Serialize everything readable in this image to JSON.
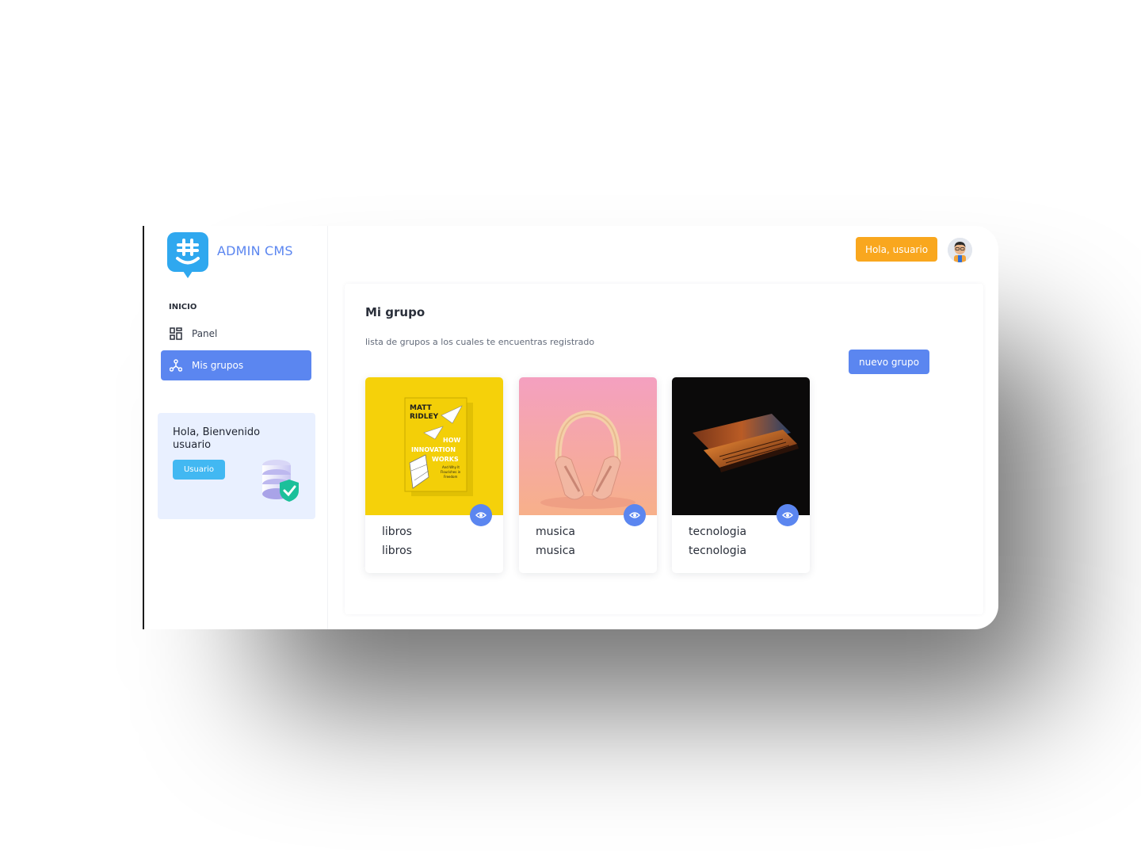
{
  "brand": {
    "name": "ADMIN CMS",
    "accent": "#5b86f0",
    "logo_icon": "hash-smile-chat-icon"
  },
  "sidebar": {
    "section_label": "INICIO",
    "items": [
      {
        "label": "Panel",
        "icon": "dashboard-grid-icon",
        "active": false
      },
      {
        "label": "Mis grupos",
        "icon": "network-nodes-icon",
        "active": true
      }
    ],
    "welcome": {
      "title": "Hola, Bienvenido usuario",
      "button": "Usuario",
      "illustration": "database-shield-icon"
    }
  },
  "header": {
    "greeting_button": "Hola, usuario",
    "avatar": "user-avatar"
  },
  "main": {
    "title": "Mi grupo",
    "subtitle": "lista de grupos a los cuales te encuentras registrado",
    "new_button": "nuevo grupo",
    "groups": [
      {
        "name": "libros",
        "description": "libros",
        "image": "book-cover-image",
        "book_text": [
          "MATT",
          "RIDLEY",
          "HOW",
          "INNOVATION",
          "WORKS",
          "And Why It",
          "Flourishes in",
          "Freedom"
        ]
      },
      {
        "name": "musica",
        "description": "musica",
        "image": "headphones-image"
      },
      {
        "name": "tecnologia",
        "description": "tecnologia",
        "image": "laptop-image"
      }
    ]
  },
  "colors": {
    "primary": "#5b86f0",
    "warning": "#f9a71e",
    "info": "#42b8f2",
    "card_bg": "#e9f0ff"
  }
}
